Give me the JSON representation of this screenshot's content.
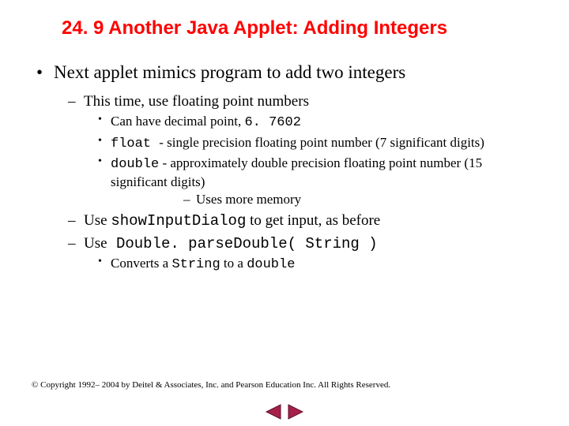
{
  "title": "24. 9  Another Java Applet: Adding Integers",
  "l1": {
    "text": "Next applet mimics program to add two integers",
    "l2a": {
      "text": "This time, use floating point numbers",
      "l3a": {
        "pre": "Can have decimal point, ",
        "code": "6. 7602"
      },
      "l3b": {
        "code": "float ",
        "post": " - single precision floating point number (7 significant digits)"
      },
      "l3c": {
        "code": "double",
        "post": " - approximately double precision floating point number (15 significant digits)",
        "l4a": "Uses more memory"
      }
    },
    "l2b": {
      "pre": "Use ",
      "code": "showInputDialog",
      "post": " to get input, as before"
    },
    "l2c": {
      "pre": "Use",
      "code": " Double. parseDouble( String )",
      "l3a": {
        "pre": "Converts a ",
        "code1": "String",
        "mid": " to a ",
        "code2": "double"
      }
    }
  },
  "footer": "© Copyright 1992– 2004 by Deitel & Associates, Inc. and Pearson Education Inc. All Rights Reserved."
}
